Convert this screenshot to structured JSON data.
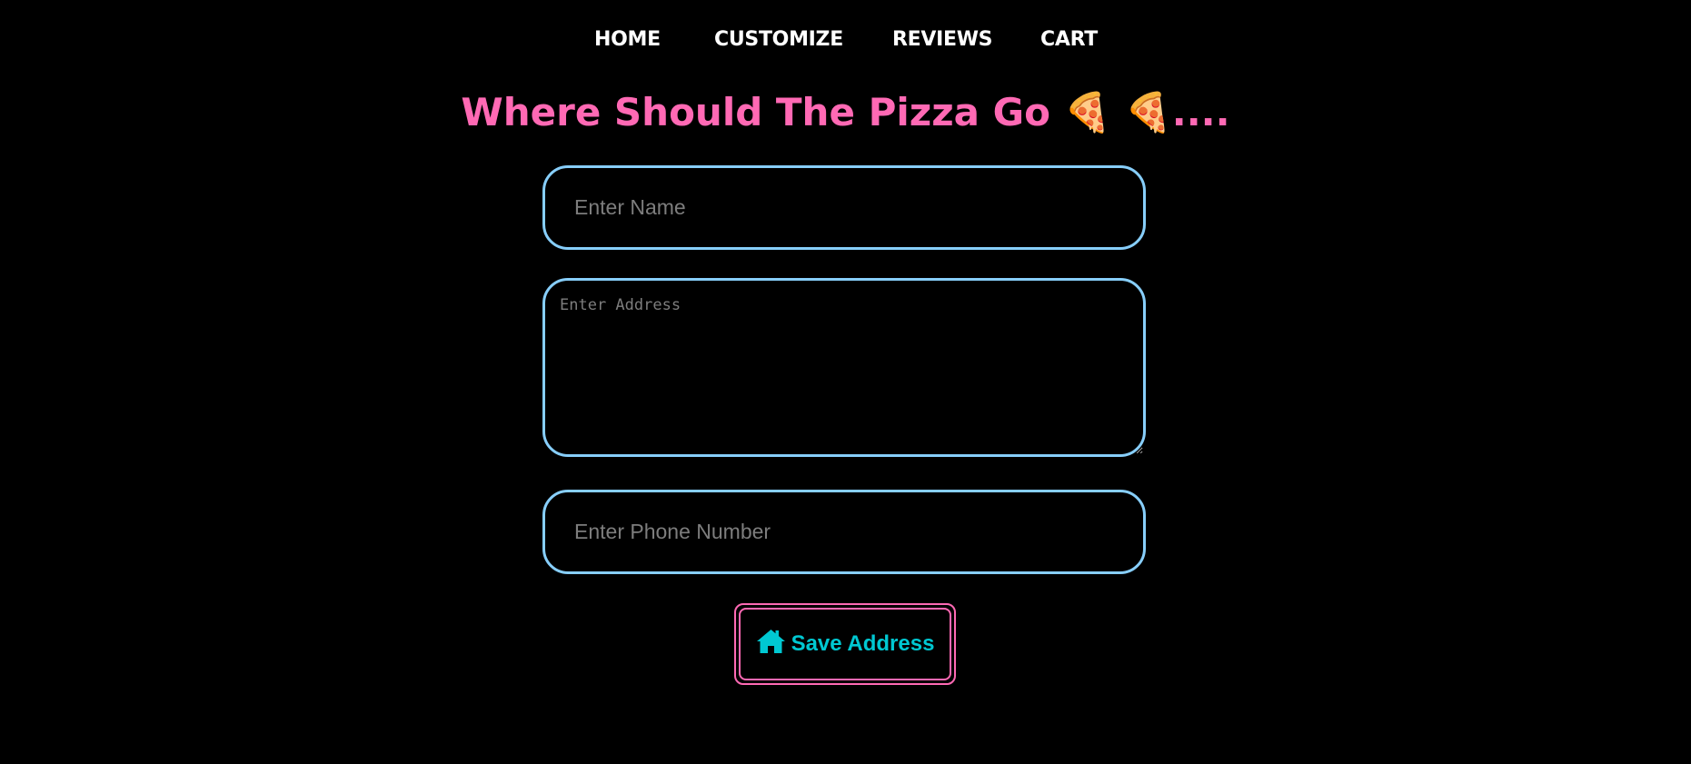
{
  "nav": {
    "items": [
      {
        "label": "HOME"
      },
      {
        "label": "CUSTOMIZE"
      },
      {
        "label": "REVIEWS"
      },
      {
        "label": "CART"
      }
    ]
  },
  "heading": {
    "text": "Where Should The Pizza Go 🍕 🍕...."
  },
  "form": {
    "name_placeholder": "Enter Name",
    "address_placeholder": "Enter Address",
    "phone_placeholder": "Enter Phone Number",
    "save_icon": "home-icon",
    "save_label": "Save Address"
  },
  "colors": {
    "background": "#000000",
    "nav_text": "#ffffff",
    "heading": "#ff69b4",
    "field_border": "#87cefa",
    "button_border": "#ff69b4",
    "button_text": "#00c8d2"
  }
}
